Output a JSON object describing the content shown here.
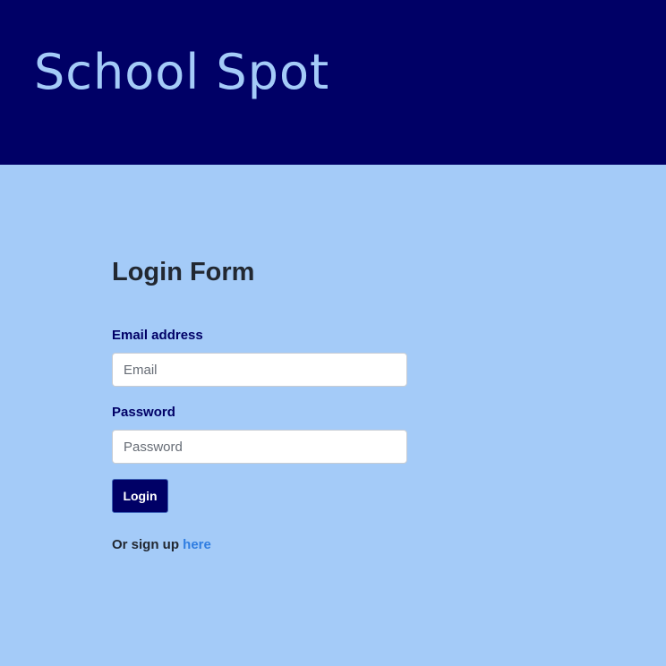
{
  "header": {
    "brand": "School Spot"
  },
  "login_form": {
    "title": "Login Form",
    "email_label": "Email address",
    "email_placeholder": "Email",
    "email_value": "",
    "password_label": "Password",
    "password_placeholder": "Password",
    "password_value": "",
    "submit_label": "Login",
    "signup_prefix": "Or sign up",
    "signup_link": "here"
  },
  "colors": {
    "header_bg": "#000066",
    "page_bg": "#a4cbf8",
    "brand_text": "#a4cbf8",
    "button_bg": "#000066",
    "link": "#2f7de1"
  }
}
